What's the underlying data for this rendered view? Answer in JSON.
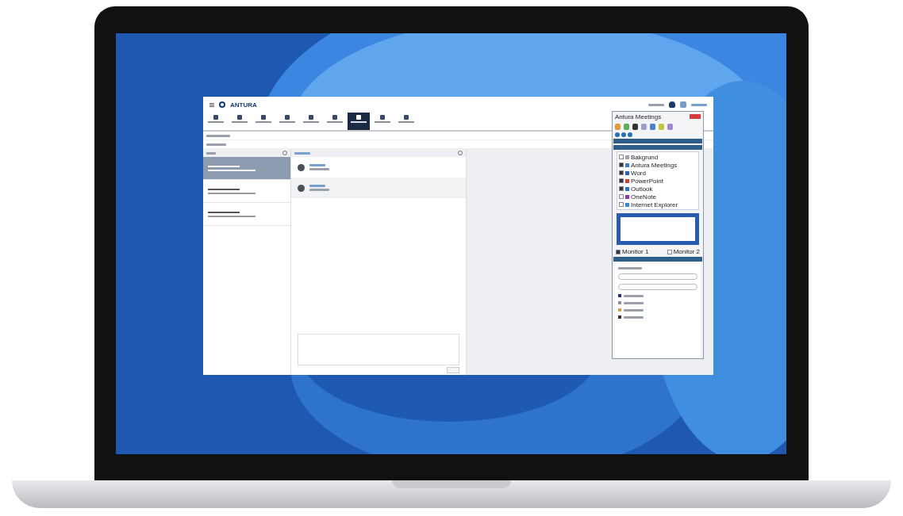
{
  "app": {
    "logo": "ANTURA",
    "tabs": [
      {
        "selected": false
      },
      {
        "selected": false
      },
      {
        "selected": false
      },
      {
        "selected": false
      },
      {
        "selected": false
      },
      {
        "selected": false
      },
      {
        "selected": true
      },
      {
        "selected": false
      },
      {
        "selected": false
      }
    ]
  },
  "conversations": [
    {
      "selected": true
    },
    {
      "selected": false
    },
    {
      "selected": false
    }
  ],
  "meetings_panel": {
    "title": "Antura Meetings",
    "apps": [
      {
        "label": "Bakgrund",
        "checked": false
      },
      {
        "label": "Antura Meetings",
        "checked": true
      },
      {
        "label": "Word",
        "checked": true
      },
      {
        "label": "PowerPoint",
        "checked": true
      },
      {
        "label": "Outlook",
        "checked": true
      },
      {
        "label": "OneNote",
        "checked": false
      },
      {
        "label": "Internet Explorer",
        "checked": false
      }
    ],
    "monitors": [
      {
        "label": "Monitor 1",
        "checked": true
      },
      {
        "label": "Monitor 2",
        "checked": false
      }
    ],
    "participants": [
      {
        "color": "#24306a"
      },
      {
        "color": "#8a8f99"
      },
      {
        "color": "#e0a040"
      },
      {
        "color": "#3a2f30"
      }
    ]
  }
}
